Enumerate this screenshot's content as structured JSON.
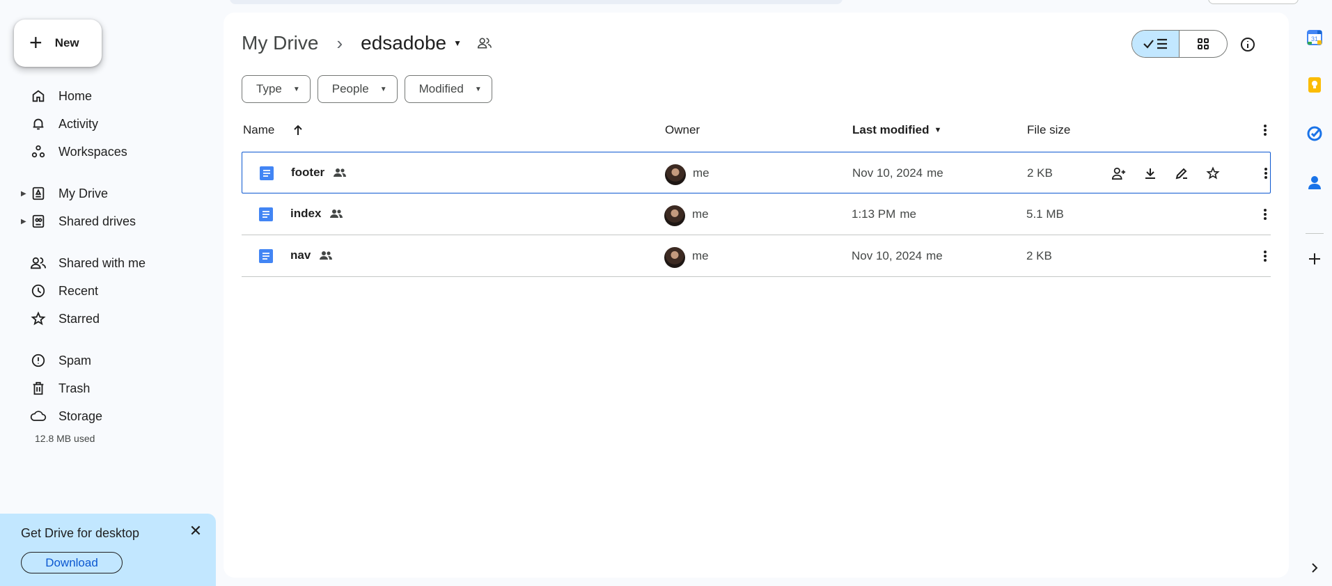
{
  "new_button": {
    "label": "New"
  },
  "nav": {
    "group1": [
      {
        "label": "Home",
        "icon": "home-icon"
      },
      {
        "label": "Activity",
        "icon": "bell-icon"
      },
      {
        "label": "Workspaces",
        "icon": "workspaces-icon"
      }
    ],
    "group2": [
      {
        "label": "My Drive",
        "icon": "my-drive-icon"
      },
      {
        "label": "Shared drives",
        "icon": "shared-drives-icon"
      }
    ],
    "group3": [
      {
        "label": "Shared with me",
        "icon": "people-icon"
      },
      {
        "label": "Recent",
        "icon": "clock-icon"
      },
      {
        "label": "Starred",
        "icon": "star-icon"
      }
    ],
    "group4": [
      {
        "label": "Spam",
        "icon": "spam-icon"
      },
      {
        "label": "Trash",
        "icon": "trash-icon"
      },
      {
        "label": "Storage",
        "icon": "cloud-icon"
      }
    ],
    "storage_used": "12.8 MB used"
  },
  "promo": {
    "title": "Get Drive for desktop",
    "download_label": "Download"
  },
  "breadcrumb": {
    "root": "My Drive",
    "current": "edsadobe"
  },
  "filters": [
    "Type",
    "People",
    "Modified"
  ],
  "table": {
    "columns": {
      "name": "Name",
      "owner": "Owner",
      "modified": "Last modified",
      "size": "File size"
    },
    "rows": [
      {
        "name": "footer",
        "owner": "me",
        "modified": "Nov 10, 2024",
        "modified_by": "me",
        "size": "2 KB",
        "selected": true
      },
      {
        "name": "index",
        "owner": "me",
        "modified": "1:13 PM",
        "modified_by": "me",
        "size": "5.1 MB",
        "selected": false
      },
      {
        "name": "nav",
        "owner": "me",
        "modified": "Nov 10, 2024",
        "modified_by": "me",
        "size": "2 KB",
        "selected": false
      }
    ]
  },
  "colors": {
    "accent": "#0b57d0",
    "selected_bg": "#c2e7ff",
    "doc_blue": "#4285f4",
    "page_bg": "#f8fafd"
  },
  "side_panel": {
    "calendar_day": "31"
  }
}
